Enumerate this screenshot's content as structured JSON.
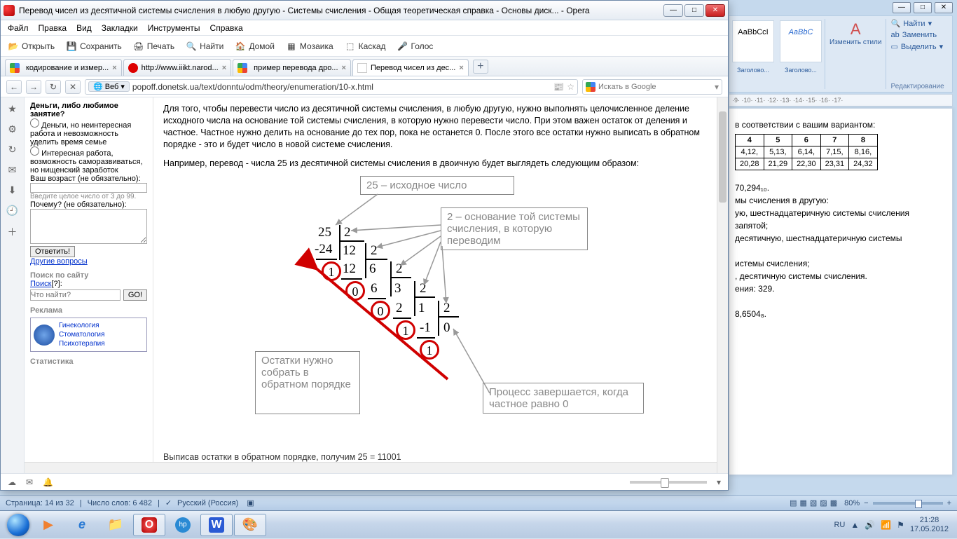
{
  "word": {
    "win_btns": [
      "—",
      "□",
      "✕"
    ],
    "styles": [
      {
        "sample": "AaBbCcI",
        "label": "Заголово..."
      },
      {
        "sample": "AaBbC",
        "label": "Заголово..."
      }
    ],
    "change_styles": "Изменить стили",
    "find": "Найти",
    "replace": "Заменить",
    "select": "Выделить",
    "edit_group": "Редактирование",
    "ruler": "·9· ·10· ·11· ·12· ·13· ·14· ·15· ·16· ·17·",
    "doc_line1": "в соответствии с вашим вариантом:",
    "table": {
      "head": [
        "4",
        "5",
        "6",
        "7",
        "8"
      ],
      "row1": [
        "4,12,",
        "5,13,",
        "6,14,",
        "7,15,",
        "8,16,"
      ],
      "row2": [
        "20,28",
        "21,29",
        "22,30",
        "23,31",
        "24,32"
      ]
    },
    "lines": [
      "70,294₁₀.",
      "мы счисления в другую:",
      "ую, шестнадцатеричную системы счисления",
      "запятой;",
      "десятичную, шестнадцатеричную системы",
      "истемы счисления;",
      ", десятичную системы счисления.",
      "ения: 329.",
      "8,6504₈."
    ],
    "status_page": "Страница: 14 из 32",
    "status_words": "Число слов: 6 482",
    "status_lang": "Русский (Россия)",
    "zoom": "80%"
  },
  "opera": {
    "title": "Перевод чисел из десятичной системы счисления в любую другую - Системы счисления - Общая теоретическая справка - Основы диск... - Opera",
    "menu": [
      "Файл",
      "Правка",
      "Вид",
      "Закладки",
      "Инструменты",
      "Справка"
    ],
    "toolbar": [
      {
        "icon": "📂",
        "label": "Открыть"
      },
      {
        "icon": "💾",
        "label": "Сохранить"
      },
      {
        "icon": "🖨",
        "label": "Печать"
      },
      {
        "icon": "🔍",
        "label": "Найти"
      },
      {
        "icon": "🏠",
        "label": "Домой"
      },
      {
        "icon": "▦",
        "label": "Мозаика"
      },
      {
        "icon": "⬚",
        "label": "Каскад"
      },
      {
        "icon": "🎤",
        "label": "Голос"
      }
    ],
    "tabs": [
      {
        "label": "кодирование и измер...",
        "active": false
      },
      {
        "label": "http://www.iiikt.narod...",
        "active": false
      },
      {
        "label": "пример перевода дро...",
        "active": false
      },
      {
        "label": "Перевод чисел из дес...",
        "active": true
      }
    ],
    "newtab": "+",
    "nav": {
      "back": "←",
      "fwd": "→",
      "reload": "↻",
      "stop": "✕"
    },
    "web_chip": "Веб",
    "url": "popoff.donetsk.ua/text/donntu/odm/theory/enumeration/10-x.html",
    "rss": "📰",
    "star": "☆",
    "search_ph": "Искать в Google",
    "side": [
      "★",
      "⚙",
      "↻",
      "✉",
      "⬇",
      "🕘",
      "＋"
    ],
    "status_icons": [
      "☁",
      "✉",
      "🔔"
    ]
  },
  "page": {
    "q_title": "Деньги, либо любимое занятие?",
    "opt1": "Деньги, но неинтересная работа и невозможность уделить время семье",
    "opt2": "Интересная работа, возможность саморазвиваться, но нищенский заработок",
    "age_label": "Ваш возраст (не обязательно):",
    "age_hint": "Введите целое число от 3 до 99.",
    "why_label": "Почему? (не обязательно):",
    "submit": "Ответить!",
    "other_link": "Другие вопросы",
    "search_title": "Поиск по сайту",
    "search_link": "Поиск",
    "search_q": "[?]",
    "search_ph": "Что найти?",
    "go": "GO!",
    "ad_title": "Реклама",
    "ad": [
      "Гинекология",
      "Стоматология",
      "Психотерапия"
    ],
    "stats": "Статистика",
    "para1": "Для того, чтобы перевести число из десятичной системы счисления, в любую другую, нужно выполнять целочисленное деление исходного числа на основание той системы счисления, в которую нужно перевести число. При этом важен остаток от деления и частное. Частное нужно делить на основание до тех пор, пока не останется 0. После этого все остатки нужно выписать в обратном порядке - это и будет число в новой системе счисления.",
    "para2": "Например, перевод - числа 25 из десятичной системы счисления в двоичную будет выглядеть следующим образом:",
    "box1": "25 – исходное число",
    "box2": "2 – основание той системы счисления, в которую переводим",
    "box3": "Остатки нужно собрать в обратном порядке",
    "box4": "Процесс завершается, когда частное равно 0",
    "cut": "Выписав остатки в обратном порядке, получим 25 = 11001"
  },
  "taskbar": {
    "apps": [
      {
        "name": "media",
        "glyph": "▶",
        "active": false,
        "color": "#f08030"
      },
      {
        "name": "ie",
        "glyph": "e",
        "active": false,
        "color": "#2a7ad4"
      },
      {
        "name": "explorer",
        "glyph": "📁",
        "active": false,
        "color": "#f0c060"
      },
      {
        "name": "opera",
        "glyph": "O",
        "active": true,
        "color": "#d02020"
      },
      {
        "name": "hp",
        "glyph": "hp",
        "active": false,
        "color": "#2a8ad4"
      },
      {
        "name": "word",
        "glyph": "W",
        "active": true,
        "color": "#2a5ad4"
      },
      {
        "name": "paint",
        "glyph": "🎨",
        "active": true,
        "color": "#f0a050"
      }
    ],
    "lang": "RU",
    "time": "21:28",
    "date": "17.05.2012",
    "tray_icons": [
      "▲",
      "🔊",
      "📶",
      "⚑"
    ]
  }
}
